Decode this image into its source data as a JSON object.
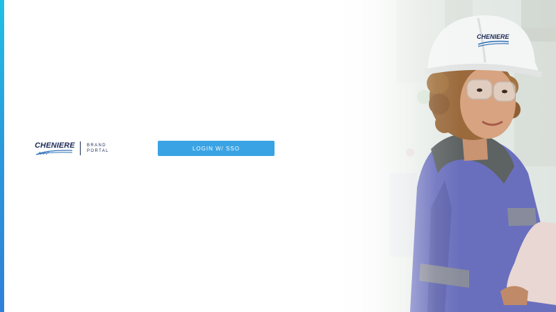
{
  "logo": {
    "brand": "CHENIERE",
    "sub_line_1": "BRAND",
    "sub_line_2": "PORTAL"
  },
  "login": {
    "sso_button_label": "LOGIN W/ SSO"
  },
  "hero": {
    "helmet_brand": "CHENIERE"
  },
  "colors": {
    "accent": "#3aa3e4",
    "brand_navy": "#1b2a56",
    "accent_bar_top": "#1fc0e6",
    "accent_bar_bottom": "#2f80d8"
  }
}
